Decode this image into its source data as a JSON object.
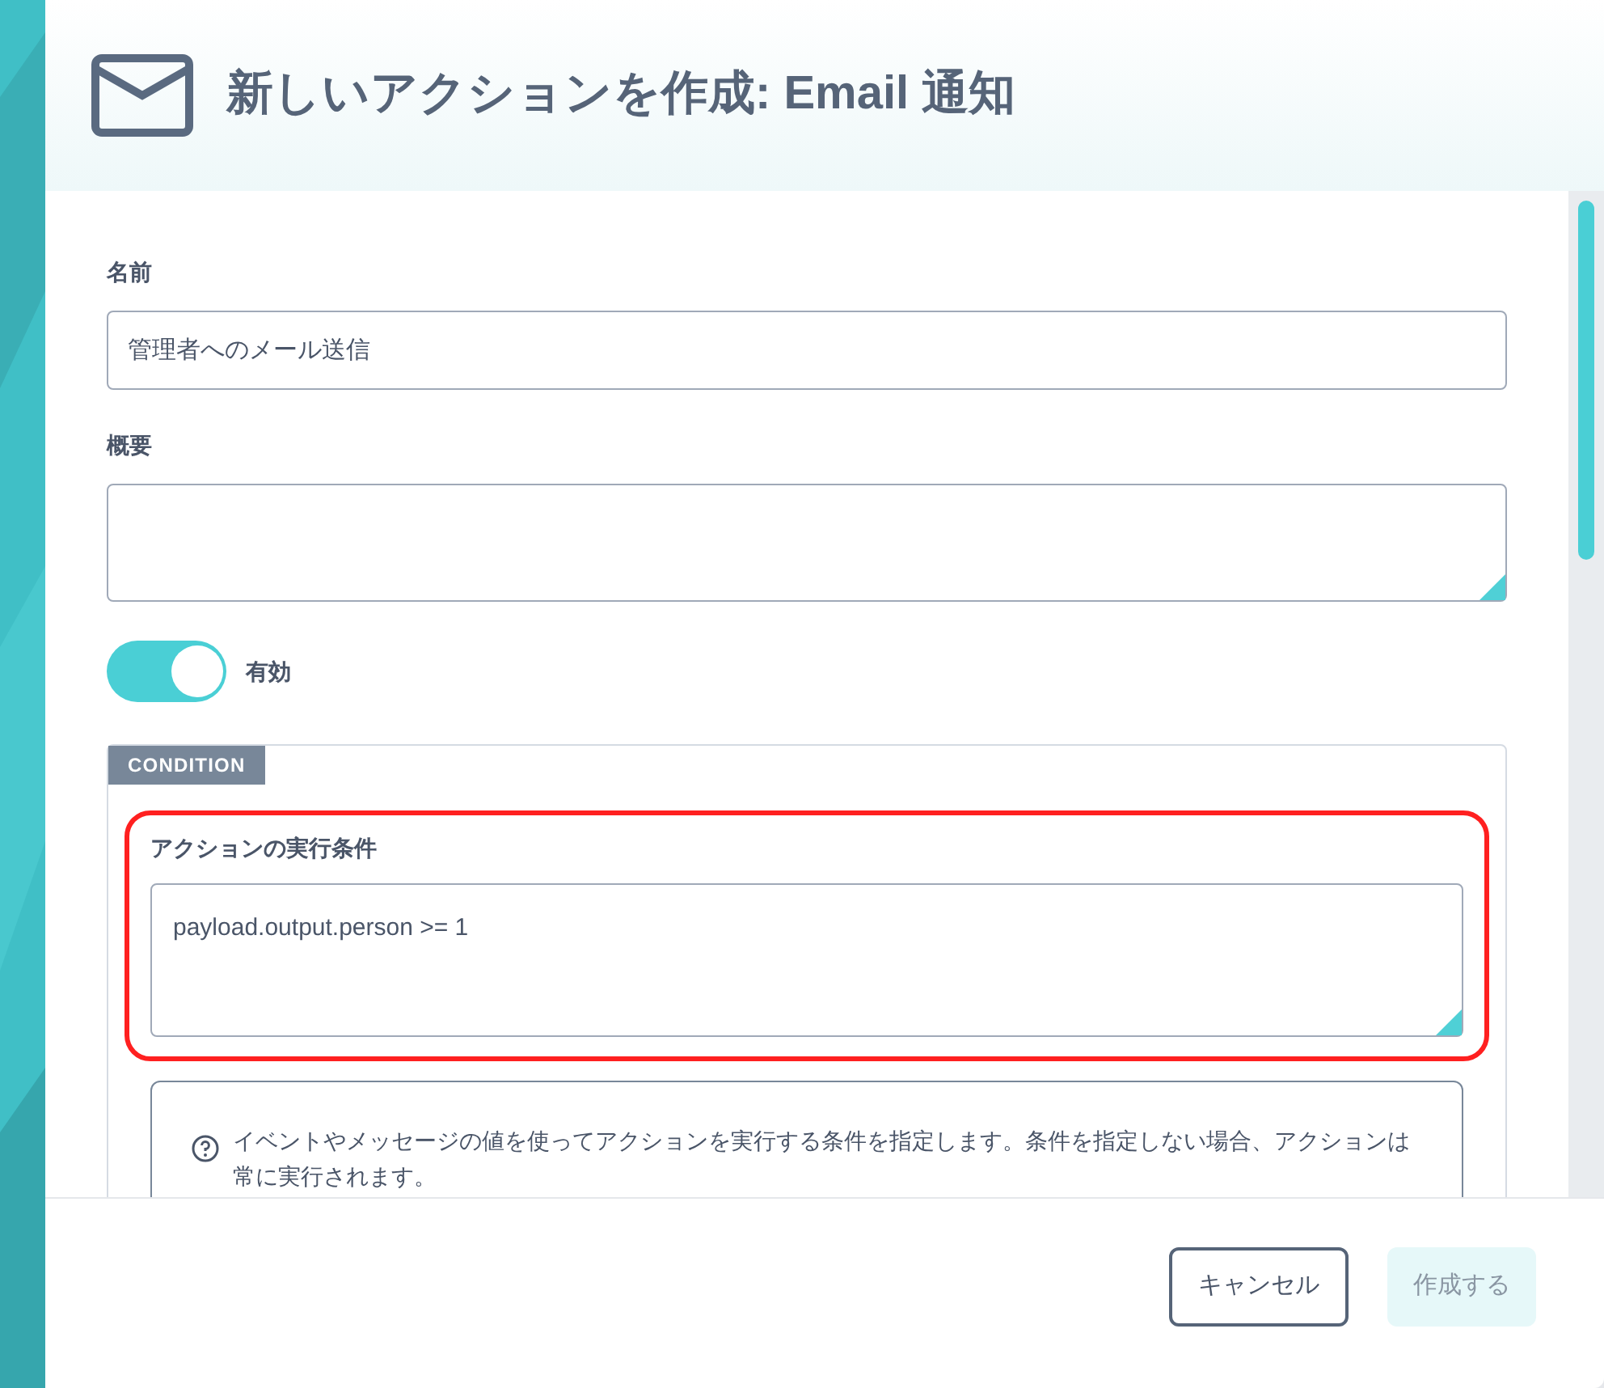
{
  "dialog": {
    "title": "新しいアクションを作成: Email 通知"
  },
  "fields": [
    {
      "label": "名前",
      "value": "管理者へのメール送信",
      "kind": "input"
    },
    {
      "label": "概要",
      "kind": "textarea"
    }
  ],
  "toggle": {
    "label": "有効",
    "on": true
  },
  "condition": {
    "tab": "CONDITION",
    "label": "アクションの実行条件",
    "value": "payload.output.person >= 1",
    "highlighted": true,
    "help": "イベントやメッセージの値を使ってアクションを実行する条件を指定します。条件を指定しない場合、アクションは常に実行されます。"
  },
  "buttons": [
    {
      "label": "キャンセル",
      "disabled": false
    },
    {
      "label": "作成する",
      "disabled": true
    }
  ]
}
